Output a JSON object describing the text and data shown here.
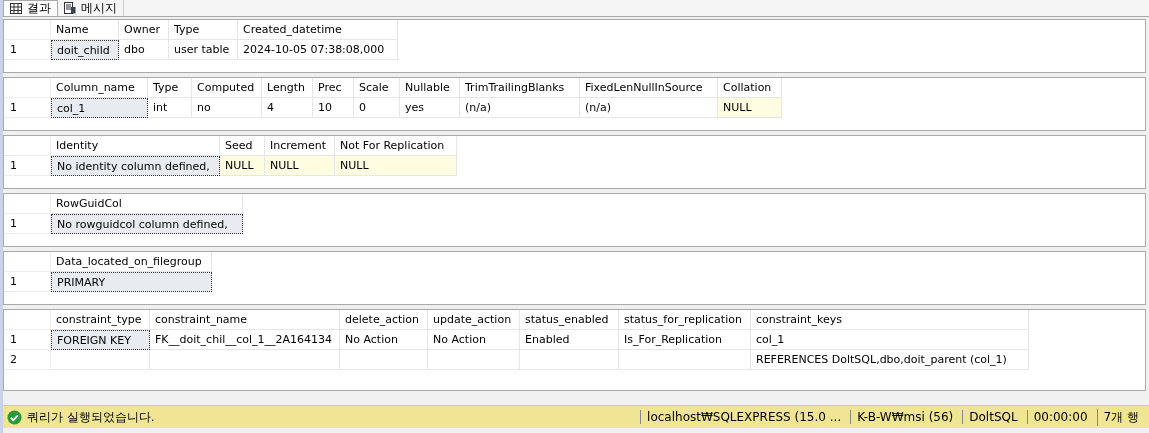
{
  "tabs": [
    {
      "label": "결과",
      "kind": "grid",
      "selected": true
    },
    {
      "label": "메시지",
      "kind": "messages",
      "selected": false
    }
  ],
  "grids": [
    {
      "columns": [
        "Name",
        "Owner",
        "Type",
        "Created_datetime"
      ],
      "rows": [
        {
          "number": "1",
          "cells": [
            {
              "text": "doit_child",
              "kind": "value",
              "selected": true
            },
            {
              "text": "dbo",
              "kind": "value",
              "selected": false
            },
            {
              "text": "user table",
              "kind": "value",
              "selected": false
            },
            {
              "text": "2024-10-05 07:38:08,000",
              "kind": "value",
              "selected": false
            }
          ]
        }
      ]
    },
    {
      "columns": [
        "Column_name",
        "Type",
        "Computed",
        "Length",
        "Prec",
        "Scale",
        "Nullable",
        "TrimTrailingBlanks",
        "FixedLenNullInSource",
        "Collation"
      ],
      "rows": [
        {
          "number": "1",
          "cells": [
            {
              "text": "col_1",
              "kind": "value",
              "selected": true
            },
            {
              "text": "int",
              "kind": "value",
              "selected": false
            },
            {
              "text": "no",
              "kind": "value",
              "selected": false
            },
            {
              "text": "4",
              "kind": "value",
              "selected": false
            },
            {
              "text": "10",
              "kind": "value",
              "selected": false
            },
            {
              "text": "0",
              "kind": "value",
              "selected": false
            },
            {
              "text": "yes",
              "kind": "value",
              "selected": false
            },
            {
              "text": "(n/a)",
              "kind": "value",
              "selected": false
            },
            {
              "text": "(n/a)",
              "kind": "value",
              "selected": false
            },
            {
              "text": "NULL",
              "kind": "null",
              "selected": false
            }
          ]
        }
      ]
    },
    {
      "columns": [
        "Identity",
        "Seed",
        "Increment",
        "Not For Replication"
      ],
      "rows": [
        {
          "number": "1",
          "cells": [
            {
              "text": "No identity column defined,",
              "kind": "value",
              "selected": true
            },
            {
              "text": "NULL",
              "kind": "null",
              "selected": false
            },
            {
              "text": "NULL",
              "kind": "null",
              "selected": false
            },
            {
              "text": "NULL",
              "kind": "null",
              "selected": false
            }
          ]
        }
      ]
    },
    {
      "columns": [
        "RowGuidCol"
      ],
      "rows": [
        {
          "number": "1",
          "cells": [
            {
              "text": "No rowguidcol column defined,",
              "kind": "value",
              "selected": true
            }
          ]
        }
      ]
    },
    {
      "columns": [
        "Data_located_on_filegroup"
      ],
      "rows": [
        {
          "number": "1",
          "cells": [
            {
              "text": "PRIMARY",
              "kind": "value",
              "selected": true
            }
          ]
        }
      ]
    },
    {
      "columns": [
        "constraint_type",
        "constraint_name",
        "delete_action",
        "update_action",
        "status_enabled",
        "status_for_replication",
        "constraint_keys"
      ],
      "rows": [
        {
          "number": "1",
          "cells": [
            {
              "text": "FOREIGN KEY",
              "kind": "value",
              "selected": true
            },
            {
              "text": "FK__doit_chil__col_1__2A164134",
              "kind": "value",
              "selected": false
            },
            {
              "text": "No Action",
              "kind": "value",
              "selected": false
            },
            {
              "text": "No Action",
              "kind": "value",
              "selected": false
            },
            {
              "text": "Enabled",
              "kind": "value",
              "selected": false
            },
            {
              "text": "Is_For_Replication",
              "kind": "value",
              "selected": false
            },
            {
              "text": "col_1",
              "kind": "value",
              "selected": false
            }
          ]
        },
        {
          "number": "2",
          "cells": [
            {
              "kind": "empty",
              "selected": false
            },
            {
              "kind": "empty",
              "selected": false
            },
            {
              "kind": "empty",
              "selected": false
            },
            {
              "kind": "empty",
              "selected": false
            },
            {
              "kind": "empty",
              "selected": false
            },
            {
              "kind": "empty",
              "selected": false
            },
            {
              "text": "REFERENCES DoltSQL,dbo,doit_parent (col_1)",
              "kind": "value",
              "selected": false
            }
          ]
        }
      ]
    }
  ],
  "status_bar": {
    "message": "쿼리가 실행되었습니다.",
    "server": "localhost₩SQLEXPRESS (15.0 ...",
    "user": "K-B-W₩msi (56)",
    "database": "DoltSQL",
    "elapsed": "00:00:00",
    "rows": "7개 행"
  }
}
